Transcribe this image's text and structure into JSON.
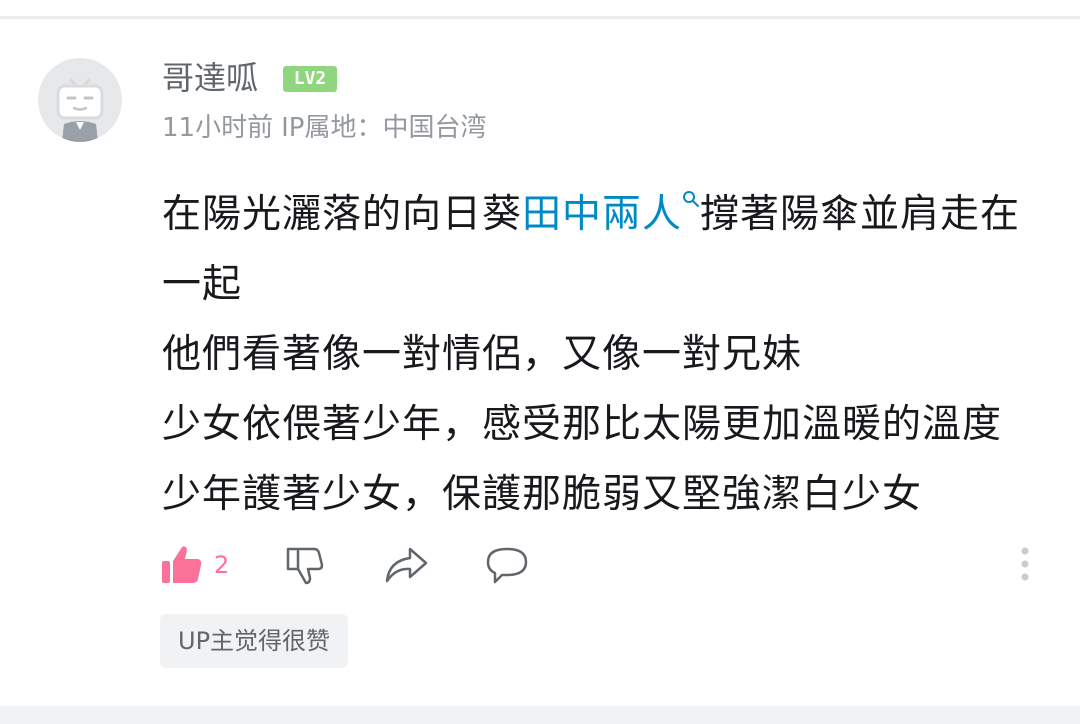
{
  "comment": {
    "username": "哥達呱",
    "level": "LV2",
    "time_ago": "11小时前",
    "ip_location_label": "IP属地：中国台湾",
    "content_lines": [
      {
        "before": "在陽光灑落的向日葵",
        "link": "田中兩人",
        "after": "撐著陽傘並肩走在一起"
      },
      {
        "text": "他們看著像一對情侶，又像一對兄妹"
      },
      {
        "text": "少女依偎著少年，感受那比太陽更加溫暖的溫度"
      },
      {
        "text": "少年護著少女，保護那脆弱又堅強潔白少女"
      }
    ],
    "like_count": "2",
    "up_liked_label": "UP主觉得很赞"
  },
  "icons": {
    "avatar": "bilibili-tv-avatar",
    "like": "thumbs-up-icon",
    "dislike": "thumbs-down-icon",
    "share": "share-arrow-icon",
    "reply": "chat-bubble-icon",
    "more": "vertical-dots-icon",
    "search": "search-icon"
  },
  "colors": {
    "like_active": "#fb7299",
    "link": "#008ac5",
    "level_badge": "#8fd67e",
    "meta_text": "#9499a0"
  }
}
